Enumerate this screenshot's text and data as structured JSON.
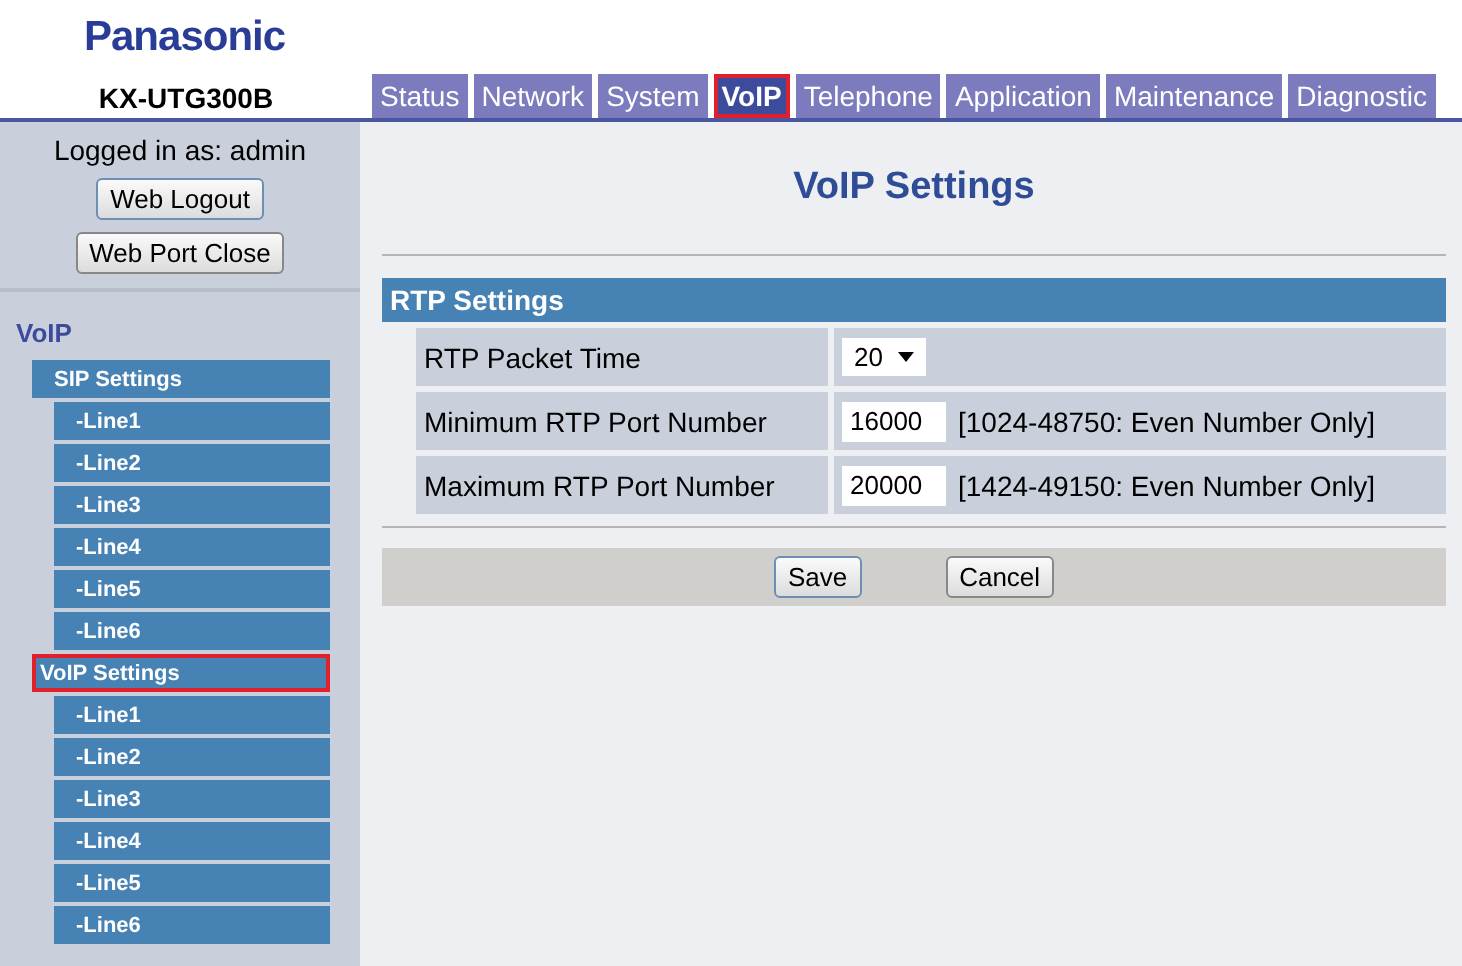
{
  "brand": "Panasonic",
  "model": "KX-UTG300B",
  "tabs": [
    {
      "label": "Status",
      "selected": false,
      "highlighted": false
    },
    {
      "label": "Network",
      "selected": false,
      "highlighted": false
    },
    {
      "label": "System",
      "selected": false,
      "highlighted": false
    },
    {
      "label": "VoIP",
      "selected": true,
      "highlighted": true
    },
    {
      "label": "Telephone",
      "selected": false,
      "highlighted": false
    },
    {
      "label": "Application",
      "selected": false,
      "highlighted": false
    },
    {
      "label": "Maintenance",
      "selected": false,
      "highlighted": false
    },
    {
      "label": "Diagnostic",
      "selected": false,
      "highlighted": false
    }
  ],
  "sidebar": {
    "login_text": "Logged in as: admin",
    "buttons": [
      "Web Logout",
      "Web Port Close"
    ],
    "section": "VoIP",
    "items": [
      {
        "label": "SIP Settings",
        "highlighted": false,
        "children": [
          {
            "label": "-Line1"
          },
          {
            "label": "-Line2"
          },
          {
            "label": "-Line3"
          },
          {
            "label": "-Line4"
          },
          {
            "label": "-Line5"
          },
          {
            "label": "-Line6"
          }
        ]
      },
      {
        "label": "VoIP Settings",
        "highlighted": true,
        "children": [
          {
            "label": "-Line1"
          },
          {
            "label": "-Line2"
          },
          {
            "label": "-Line3"
          },
          {
            "label": "-Line4"
          },
          {
            "label": "-Line5"
          },
          {
            "label": "-Line6"
          }
        ]
      }
    ]
  },
  "page_title": "VoIP Settings",
  "panel": {
    "title": "RTP Settings",
    "rows": [
      {
        "kind": "select",
        "label": "RTP Packet Time",
        "value": "20"
      },
      {
        "kind": "input",
        "label": "Minimum RTP Port Number",
        "value": "16000",
        "hint": "[1024-48750: Even Number Only]"
      },
      {
        "kind": "input",
        "label": "Maximum RTP Port Number",
        "value": "20000",
        "hint": "[1424-49150: Even Number Only]"
      }
    ]
  },
  "buttons": [
    "Save",
    "Cancel"
  ]
}
